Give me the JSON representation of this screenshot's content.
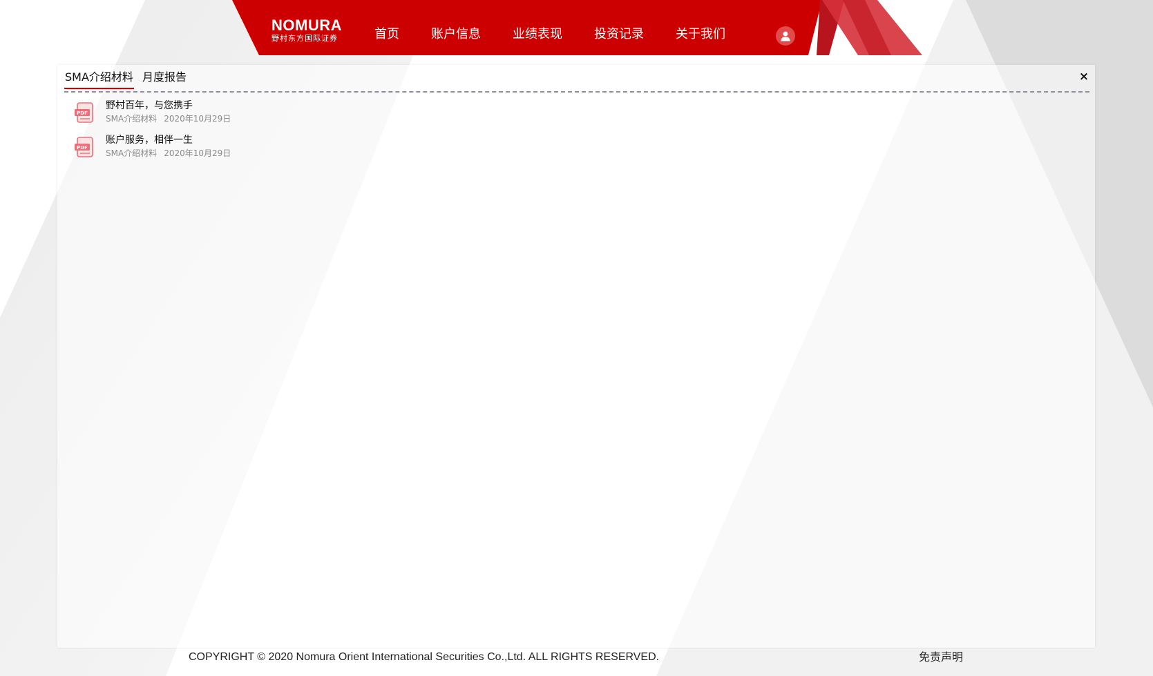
{
  "header": {
    "logo": {
      "word": "NOMURA",
      "sub": "野村东方国际证券"
    },
    "nav": [
      {
        "label": "首页"
      },
      {
        "label": "账户信息"
      },
      {
        "label": "业绩表现"
      },
      {
        "label": "投资记录"
      },
      {
        "label": "关于我们"
      }
    ],
    "avatar_icon": "user-icon"
  },
  "panel": {
    "tabs": [
      {
        "label": "SMA介绍材料",
        "active": true
      },
      {
        "label": "月度报告",
        "active": false
      }
    ],
    "close_label": "×",
    "documents": [
      {
        "title": "野村百年，与您携手",
        "category": "SMA介绍材料",
        "date": "2020年10月29日",
        "icon": "pdf-icon"
      },
      {
        "title": "账户服务，相伴一生",
        "category": "SMA介绍材料",
        "date": "2020年10月29日",
        "icon": "pdf-icon"
      }
    ]
  },
  "footer": {
    "copyright": "COPYRIGHT © 2020 Nomura Orient International Securities Co.,Ltd. ALL RIGHTS RESERVED.",
    "disclaimer": "免责声明"
  },
  "colors": {
    "brand_red": "#cc0000",
    "accent_red": "#e04b4b",
    "text": "#222222",
    "muted": "#8a8a8a"
  }
}
